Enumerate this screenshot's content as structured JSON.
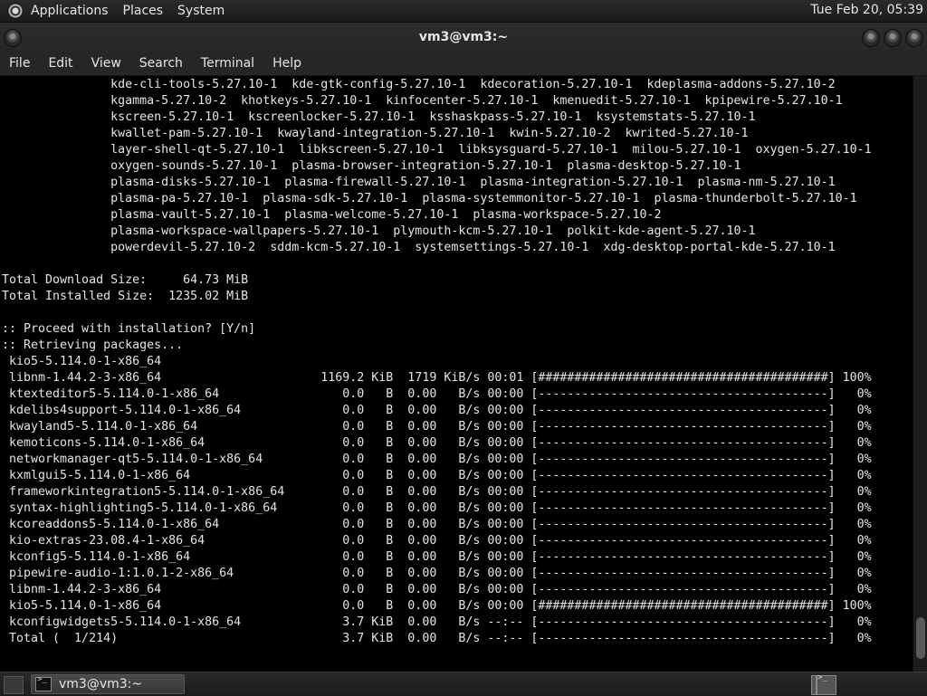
{
  "top_panel": {
    "menus": [
      "Applications",
      "Places",
      "System"
    ],
    "clock": "Tue Feb 20, 05:39"
  },
  "window": {
    "title": "vm3@vm3:~"
  },
  "menubar": {
    "items": [
      "File",
      "Edit",
      "View",
      "Search",
      "Terminal",
      "Help"
    ]
  },
  "terminal": {
    "lines": [
      "               kde-cli-tools-5.27.10-1  kde-gtk-config-5.27.10-1  kdecoration-5.27.10-1  kdeplasma-addons-5.27.10-2",
      "               kgamma-5.27.10-2  khotkeys-5.27.10-1  kinfocenter-5.27.10-1  kmenuedit-5.27.10-1  kpipewire-5.27.10-1",
      "               kscreen-5.27.10-1  kscreenlocker-5.27.10-1  ksshaskpass-5.27.10-1  ksystemstats-5.27.10-1",
      "               kwallet-pam-5.27.10-1  kwayland-integration-5.27.10-1  kwin-5.27.10-2  kwrited-5.27.10-1",
      "               layer-shell-qt-5.27.10-1  libkscreen-5.27.10-1  libksysguard-5.27.10-1  milou-5.27.10-1  oxygen-5.27.10-1",
      "               oxygen-sounds-5.27.10-1  plasma-browser-integration-5.27.10-1  plasma-desktop-5.27.10-1",
      "               plasma-disks-5.27.10-1  plasma-firewall-5.27.10-1  plasma-integration-5.27.10-1  plasma-nm-5.27.10-1",
      "               plasma-pa-5.27.10-1  plasma-sdk-5.27.10-1  plasma-systemmonitor-5.27.10-1  plasma-thunderbolt-5.27.10-1",
      "               plasma-vault-5.27.10-1  plasma-welcome-5.27.10-1  plasma-workspace-5.27.10-2",
      "               plasma-workspace-wallpapers-5.27.10-1  plymouth-kcm-5.27.10-1  polkit-kde-agent-5.27.10-1",
      "               powerdevil-5.27.10-2  sddm-kcm-5.27.10-1  systemsettings-5.27.10-1  xdg-desktop-portal-kde-5.27.10-1",
      "",
      "Total Download Size:     64.73 MiB",
      "Total Installed Size:  1235.02 MiB",
      "",
      ":: Proceed with installation? [Y/n]",
      ":: Retrieving packages...",
      " kio5-5.114.0-1-x86_64",
      " libnm-1.44.2-3-x86_64                      1169.2 KiB  1719 KiB/s 00:01 [########################################] 100%",
      " ktexteditor5-5.114.0-1-x86_64                 0.0   B  0.00   B/s 00:00 [----------------------------------------]   0%",
      " kdelibs4support-5.114.0-1-x86_64              0.0   B  0.00   B/s 00:00 [----------------------------------------]   0%",
      " kwayland5-5.114.0-1-x86_64                    0.0   B  0.00   B/s 00:00 [----------------------------------------]   0%",
      " kemoticons-5.114.0-1-x86_64                   0.0   B  0.00   B/s 00:00 [----------------------------------------]   0%",
      " networkmanager-qt5-5.114.0-1-x86_64           0.0   B  0.00   B/s 00:00 [----------------------------------------]   0%",
      " kxmlgui5-5.114.0-1-x86_64                     0.0   B  0.00   B/s 00:00 [----------------------------------------]   0%",
      " frameworkintegration5-5.114.0-1-x86_64        0.0   B  0.00   B/s 00:00 [----------------------------------------]   0%",
      " syntax-highlighting5-5.114.0-1-x86_64         0.0   B  0.00   B/s 00:00 [----------------------------------------]   0%",
      " kcoreaddons5-5.114.0-1-x86_64                 0.0   B  0.00   B/s 00:00 [----------------------------------------]   0%",
      " kio-extras-23.08.4-1-x86_64                   0.0   B  0.00   B/s 00:00 [----------------------------------------]   0%",
      " kconfig5-5.114.0-1-x86_64                     0.0   B  0.00   B/s 00:00 [----------------------------------------]   0%",
      " pipewire-audio-1:1.0.1-2-x86_64               0.0   B  0.00   B/s 00:00 [----------------------------------------]   0%",
      " libnm-1.44.2-3-x86_64                         0.0   B  0.00   B/s 00:00 [----------------------------------------]   0%",
      " kio5-5.114.0-1-x86_64                         0.0   B  0.00   B/s 00:00 [########################################] 100%",
      " kconfigwidgets5-5.114.0-1-x86_64              3.7 KiB  0.00   B/s --:-- [----------------------------------------]   0%",
      " Total (  1/214)                               3.7 KiB  0.00   B/s --:-- [----------------------------------------]   0%"
    ]
  },
  "taskbar": {
    "task_label": "vm3@vm3:~"
  }
}
